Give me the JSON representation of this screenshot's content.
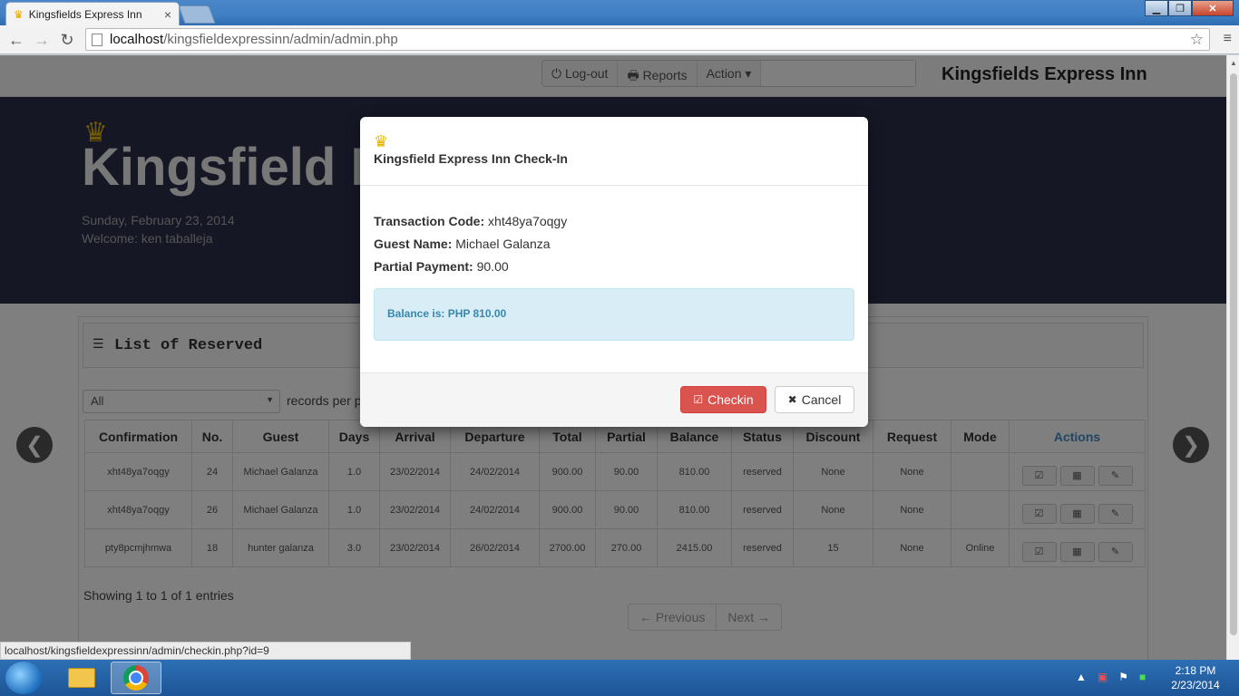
{
  "browser": {
    "tab_title": "Kingsfields Express Inn",
    "url_host": "localhost",
    "url_path": "/kingsfieldexpressinn/admin/admin.php",
    "status_url": "localhost/kingsfieldexpressinn/admin/checkin.php?id=9"
  },
  "topnav": {
    "logout_label": "Log-out",
    "reports_label": "Reports",
    "action_label": "Action",
    "brand": "Kingsfields Express Inn"
  },
  "hero": {
    "title": "Kingsfield E",
    "date": "Sunday, February 23, 2014",
    "welcome": "Welcome:  ken taballeja"
  },
  "panel": {
    "title": "List of Reserved",
    "length_value": "All",
    "length_label": "records per p",
    "info": "Showing 1 to 1 of 1 entries",
    "prev_label": "← Previous",
    "next_label": "Next →"
  },
  "table": {
    "headers": [
      "Confirmation",
      "No.",
      "Guest",
      "Days",
      "Arrival",
      "Departure",
      "Total",
      "Partial",
      "Balance",
      "Status",
      "Discount",
      "Request",
      "Mode",
      "Actions"
    ],
    "rows": [
      [
        "xht48ya7oqgy",
        "24",
        "Michael Galanza",
        "1.0",
        "23/02/2014",
        "24/02/2014",
        "900.00",
        "90.00",
        "810.00",
        "reserved",
        "None",
        "None",
        ""
      ],
      [
        "xht48ya7oqgy",
        "26",
        "Michael Galanza",
        "1.0",
        "23/02/2014",
        "24/02/2014",
        "900.00",
        "90.00",
        "810.00",
        "reserved",
        "None",
        "None",
        ""
      ],
      [
        "pty8pcmjhmwa",
        "18",
        "hunter galanza",
        "3.0",
        "23/02/2014",
        "26/02/2014",
        "2700.00",
        "270.00",
        "2415.00",
        "reserved",
        "15",
        "None",
        "Online"
      ]
    ]
  },
  "modal": {
    "title": "Kingsfield Express Inn Check-In",
    "transaction_label": "Transaction Code:",
    "transaction_value": "xht48ya7oqgy",
    "guest_label": "Guest Name:",
    "guest_value": "Michael Galanza",
    "partial_label": "Partial Payment:",
    "partial_value": "90.00",
    "balance_text": "Balance is: PHP 810.00",
    "checkin_label": "Checkin",
    "cancel_label": "Cancel"
  },
  "taskbar": {
    "time": "2:18 PM",
    "date": "2/23/2014"
  },
  "colors": {
    "checkin_button": "#d9534f",
    "alert_bg": "#d9edf7",
    "hero_bg": "#2b2f4b",
    "crown": "#e8b400"
  }
}
